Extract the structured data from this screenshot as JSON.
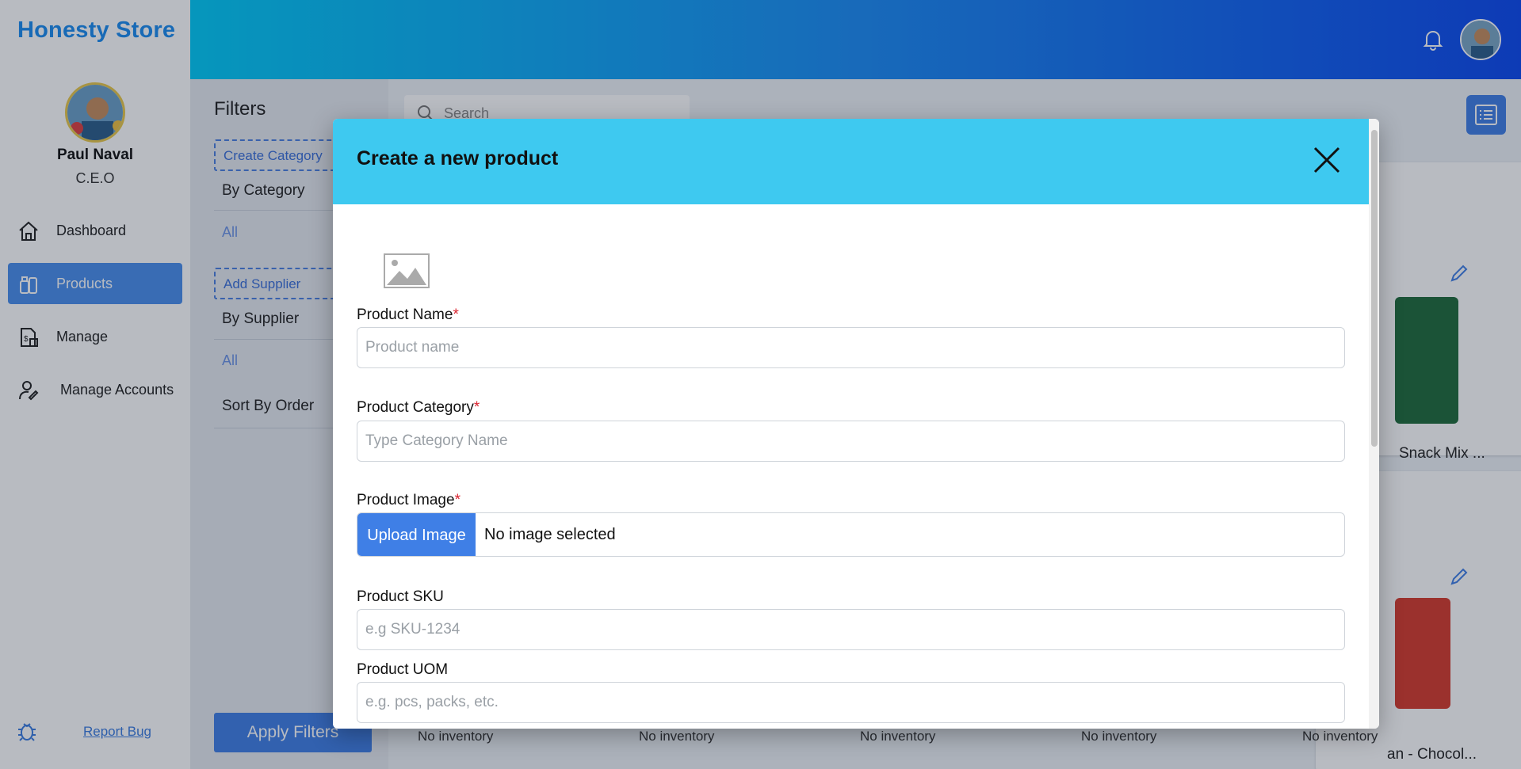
{
  "app": {
    "brand": "Honesty Store"
  },
  "user": {
    "name": "Paul Naval",
    "role": "C.E.O"
  },
  "sidebar": {
    "items": [
      {
        "label": "Dashboard",
        "icon": "home-icon"
      },
      {
        "label": "Products",
        "icon": "products-icon",
        "active": true
      },
      {
        "label": "Manage",
        "icon": "document-money-icon"
      },
      {
        "label": "Manage Accounts",
        "icon": "user-edit-icon"
      }
    ],
    "report_bug": "Report Bug"
  },
  "filters": {
    "title": "Filters",
    "create_category": "Create Category",
    "by_category": "By Category",
    "category_all": "All",
    "add_supplier": "Add Supplier",
    "by_supplier": "By Supplier",
    "supplier_all": "All",
    "sort_by_order": "Sort By Order",
    "apply": "Apply Filters"
  },
  "search": {
    "placeholder": "Search"
  },
  "products": {
    "card1_name": "Snack Mix ...",
    "card2_name": "an - Chocol...",
    "inventory_labels": [
      "No inventory",
      "No inventory",
      "No inventory",
      "No inventory",
      "No inventory"
    ]
  },
  "modal": {
    "title": "Create a new product",
    "fields": {
      "name": {
        "label": "Product Name",
        "required": "*",
        "placeholder": "Product name"
      },
      "category": {
        "label": "Product Category",
        "required": "*",
        "placeholder": "Type Category Name"
      },
      "image": {
        "label": "Product Image",
        "required": "*",
        "button": "Upload Image",
        "status": "No image selected"
      },
      "sku": {
        "label": "Product SKU",
        "placeholder": "e.g SKU-1234"
      },
      "uom": {
        "label": "Product UOM",
        "placeholder": "e.g. pcs, packs, etc."
      }
    }
  },
  "colors": {
    "accent": "#3f7fe6",
    "modal_header": "#3ec9f0",
    "brand": "#1a8cf0"
  }
}
